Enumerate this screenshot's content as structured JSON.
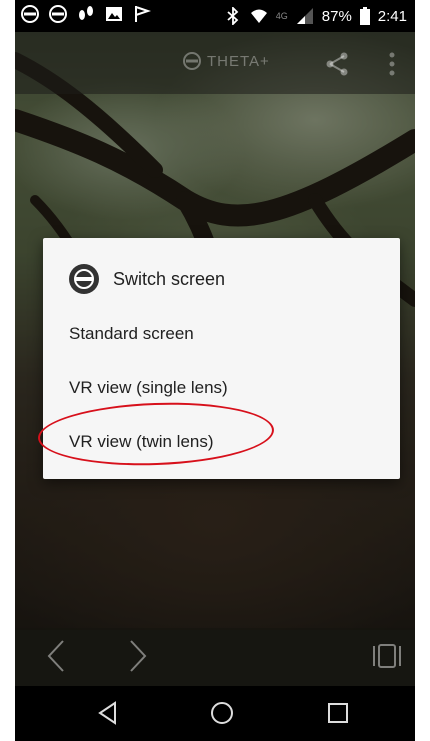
{
  "status_bar": {
    "battery": "87%",
    "time": "2:41",
    "network": "4G"
  },
  "app_bar": {
    "title": "THETA+"
  },
  "dialog": {
    "title": "Switch screen",
    "options": [
      "Standard screen",
      "VR view (single lens)",
      "VR view (twin lens)"
    ],
    "highlighted_option": "VR view (twin lens)",
    "highlight_color": "#d7101b"
  },
  "icons": {
    "dialog_icon": "theta-icon",
    "share": "share-icon",
    "menu": "overflow-menu-icon",
    "prev": "chevron-left-icon",
    "next": "chevron-right-icon",
    "vr": "vr-mode-icon",
    "back": "back-triangle-icon",
    "home": "home-circle-icon",
    "recents": "recents-square-icon"
  }
}
